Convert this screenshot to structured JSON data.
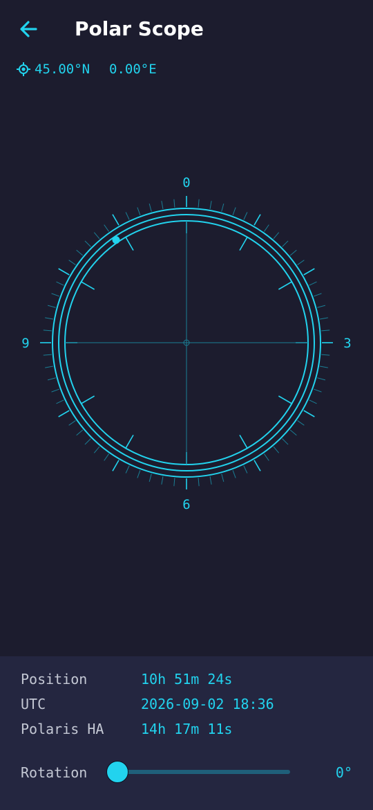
{
  "header": {
    "title": "Polar Scope",
    "back_icon": "arrow-left-icon"
  },
  "location": {
    "icon": "gps-target-icon",
    "latitude": "45.00°N",
    "longitude": "0.00°E"
  },
  "scope": {
    "labels": {
      "top": "0",
      "right": "3",
      "bottom": "6",
      "left": "9"
    },
    "polaris_clock_hours": 10.85
  },
  "info": {
    "position": {
      "label": "Position",
      "value": "10h 51m 24s"
    },
    "utc": {
      "label": "UTC",
      "value": "2026-09-02 18:36"
    },
    "polaris_ha": {
      "label": "Polaris HA",
      "value": "14h 17m 11s"
    }
  },
  "rotation": {
    "label": "Rotation",
    "value_text": "0°",
    "value": 0
  },
  "colors": {
    "accent": "#22d3ee",
    "background": "#1c1c2e",
    "panel": "#242640",
    "label": "#c4c8d4"
  }
}
